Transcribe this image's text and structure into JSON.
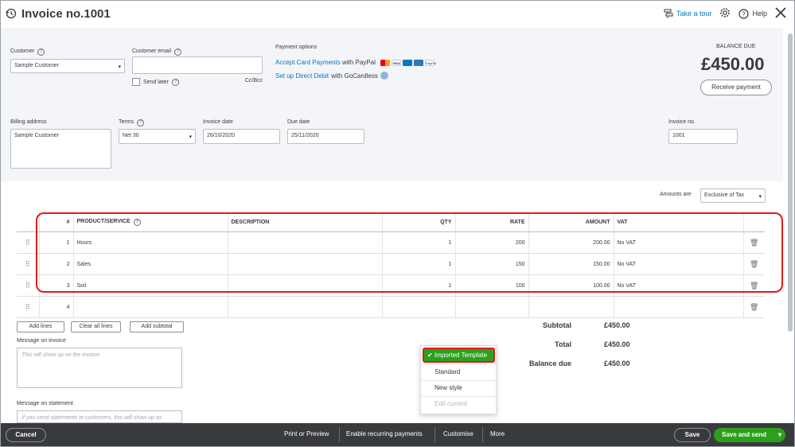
{
  "header": {
    "title": "Invoice no.1001",
    "take_tour": "Take a tour",
    "help": "Help"
  },
  "customer": {
    "label": "Customer",
    "value": "Sample Customer"
  },
  "customer_email": {
    "label": "Customer email",
    "value": "",
    "send_later": "Send later",
    "cc_bcc": "Cc/Bcc"
  },
  "payment_options": {
    "label": "Payment options",
    "accept_link": "Accept Card Payments",
    "accept_suffix": "with PayPal",
    "paypal_label": "PayPal",
    "visa_label": "VISA",
    "direct_debit_link": "Set up Direct Debit",
    "direct_debit_suffix": "with GoCardless"
  },
  "balance": {
    "label": "BALANCE DUE",
    "amount": "£450.00",
    "receive_button": "Receive payment"
  },
  "billing": {
    "label": "Billing address",
    "value": "Sample Customer"
  },
  "terms": {
    "label": "Terms",
    "value": "Net 30"
  },
  "invoice_date": {
    "label": "Invoice date",
    "value": "26/10/2020"
  },
  "due_date": {
    "label": "Due date",
    "value": "25/11/2020"
  },
  "invoice_no": {
    "label": "Invoice no.",
    "value": "1001"
  },
  "amounts_are": {
    "label": "Amounts are",
    "value": "Exclusive of Tax"
  },
  "table": {
    "headers": [
      "#",
      "PRODUCT/SERVICE",
      "DESCRIPTION",
      "QTY",
      "RATE",
      "AMOUNT",
      "VAT"
    ],
    "rows": [
      {
        "num": "1",
        "product": "Hours",
        "description": "",
        "qty": "1",
        "rate": "200",
        "amount": "200.00",
        "vat": "No VAT"
      },
      {
        "num": "2",
        "product": "Sales",
        "description": "",
        "qty": "1",
        "rate": "150",
        "amount": "150.00",
        "vat": "No VAT"
      },
      {
        "num": "3",
        "product": "Soil",
        "description": "",
        "qty": "1",
        "rate": "100",
        "amount": "100.00",
        "vat": "No VAT"
      },
      {
        "num": "4",
        "product": "",
        "description": "",
        "qty": "",
        "rate": "",
        "amount": "",
        "vat": ""
      }
    ]
  },
  "line_buttons": {
    "add_lines": "Add lines",
    "clear_all": "Clear all lines",
    "add_subtotal": "Add subtotal"
  },
  "message_invoice": {
    "label": "Message on invoice",
    "placeholder": "This will show up on the invoice."
  },
  "message_statement": {
    "label": "Message on statement",
    "placeholder": "If you send statements to customers, this will show up as"
  },
  "totals": {
    "subtotal_label": "Subtotal",
    "subtotal": "£450.00",
    "total_label": "Total",
    "total": "£450.00",
    "balance_due_label": "Balance due",
    "balance_due": "£450.00"
  },
  "customise_menu": {
    "selected": "Imported Template",
    "items": [
      "Standard",
      "New style",
      "Edit current"
    ]
  },
  "footer": {
    "cancel": "Cancel",
    "print_preview": "Print or Preview",
    "recurring": "Enable recurring payments",
    "customise": "Customise",
    "more": "More",
    "save": "Save",
    "save_send": "Save and send"
  }
}
